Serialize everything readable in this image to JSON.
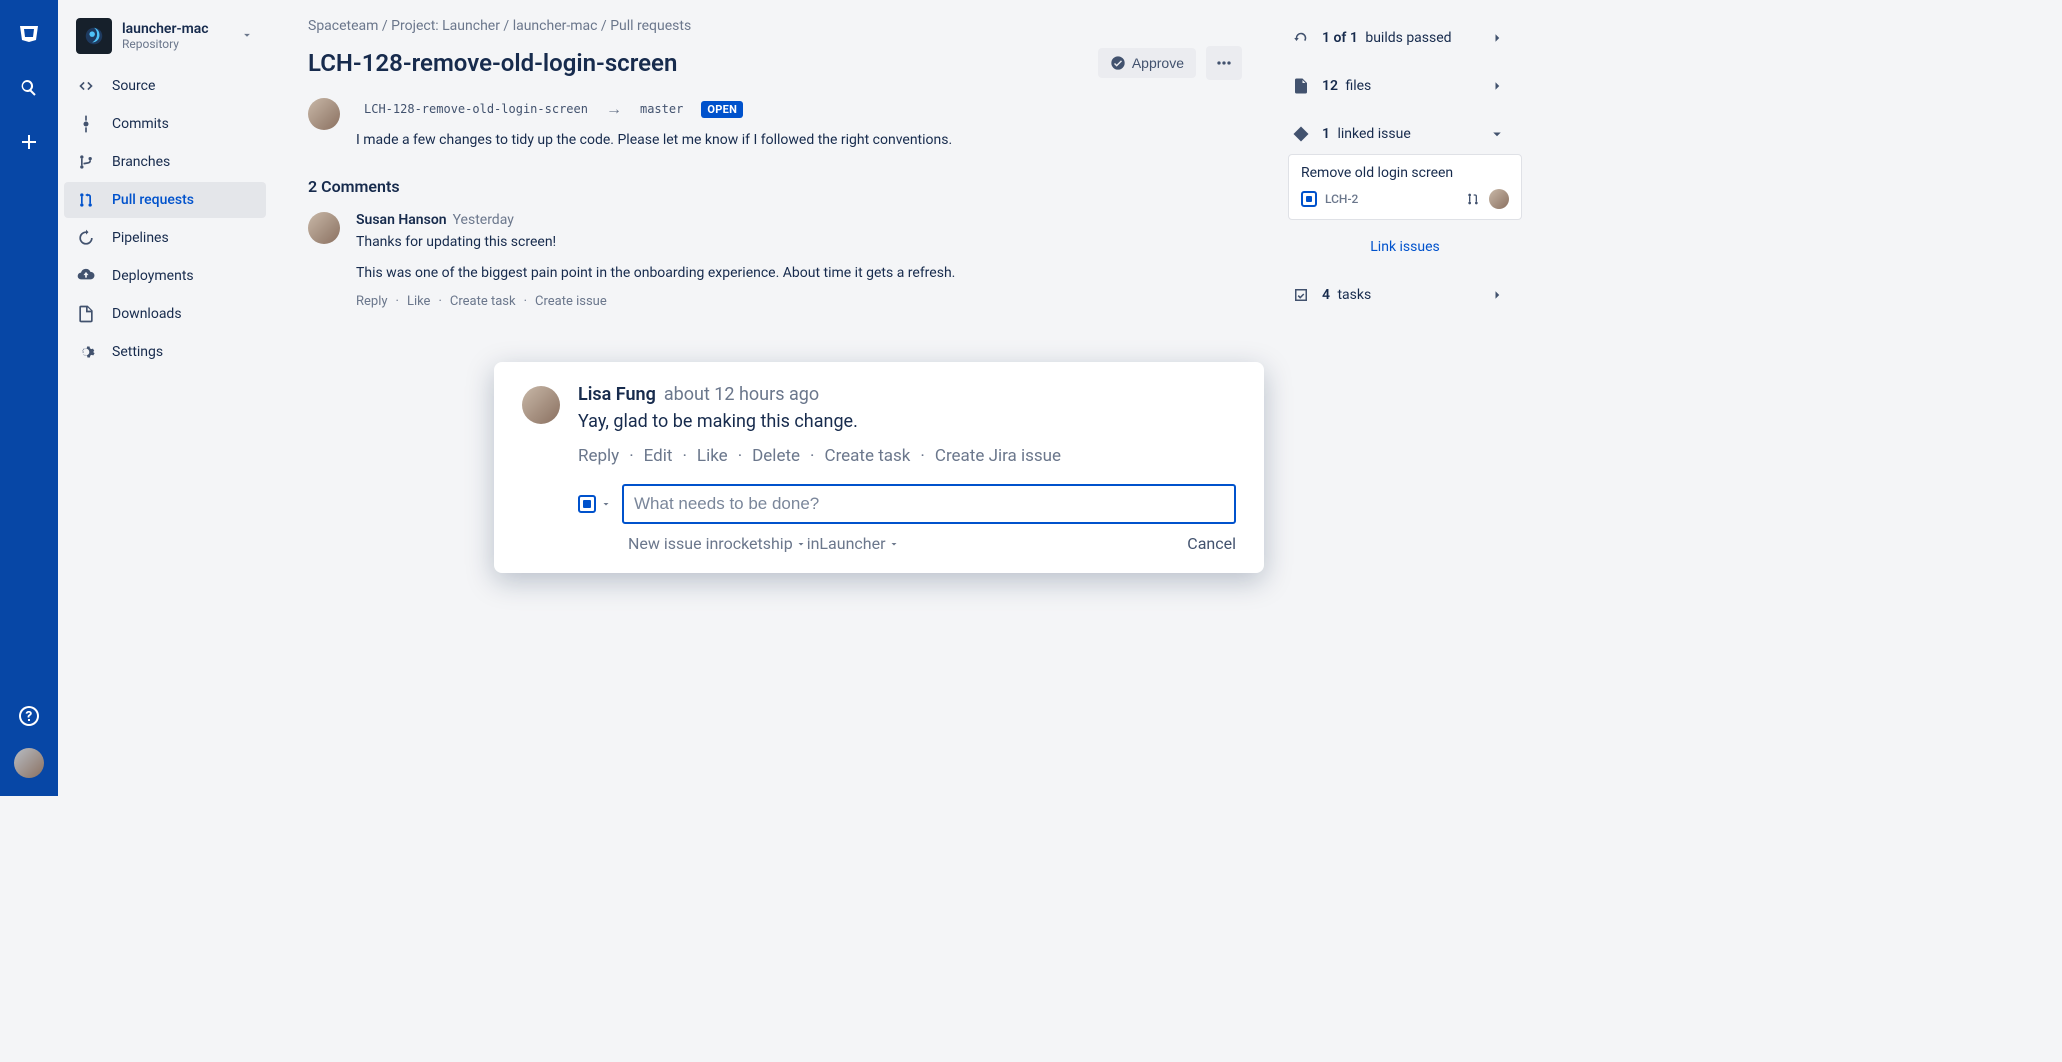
{
  "rail": {
    "icons": [
      "bitbucket",
      "search",
      "create",
      "help"
    ]
  },
  "repo": {
    "name": "launcher-mac",
    "subtitle": "Repository"
  },
  "nav": [
    {
      "label": "Source",
      "icon": "code"
    },
    {
      "label": "Commits",
      "icon": "commit"
    },
    {
      "label": "Branches",
      "icon": "branch"
    },
    {
      "label": "Pull requests",
      "icon": "pr",
      "active": true
    },
    {
      "label": "Pipelines",
      "icon": "pipe"
    },
    {
      "label": "Deployments",
      "icon": "deploy"
    },
    {
      "label": "Downloads",
      "icon": "download"
    },
    {
      "label": "Settings",
      "icon": "settings"
    }
  ],
  "breadcrumb": [
    "Spaceteam",
    "Project: Launcher",
    "launcher-mac",
    "Pull requests"
  ],
  "pr": {
    "title": "LCH-128-remove-old-login-screen",
    "approve": "Approve",
    "source_branch": "LCH-128-remove-old-login-screen",
    "target_branch": "master",
    "status": "OPEN",
    "description": "I made a few changes to tidy up the code. Please let me know if I followed the right conventions."
  },
  "comments": {
    "heading": "2 Comments",
    "list": [
      {
        "author": "Susan Hanson",
        "time": "Yesterday",
        "p1": "Thanks for updating this screen!",
        "p2": "This was one of the biggest pain point in the onboarding experience. About time it gets a refresh.",
        "actions": [
          "Reply",
          "Like",
          "Create task",
          "Create issue"
        ]
      }
    ]
  },
  "modal": {
    "author": "Lisa Fung",
    "time": "about 12 hours ago",
    "text": "Yay, glad to be making this change.",
    "actions": [
      "Reply",
      "Edit",
      "Like",
      "Delete",
      "Create task",
      "Create Jira issue"
    ],
    "placeholder": "What needs to be done?",
    "footer_prefix": "New issue in ",
    "footer_repo": "rocketship",
    "footer_in": " in ",
    "footer_project": "Launcher",
    "cancel": "Cancel"
  },
  "right": {
    "builds_a": "1 of 1",
    "builds_b": " builds passed",
    "files_n": "12",
    "files_l": " files",
    "linked_n": "1",
    "linked_l": " linked issue",
    "linked_issue": {
      "title": "Remove old login screen",
      "key": "LCH-2"
    },
    "link_issues": "Link issues",
    "tasks_n": "4",
    "tasks_l": " tasks"
  }
}
